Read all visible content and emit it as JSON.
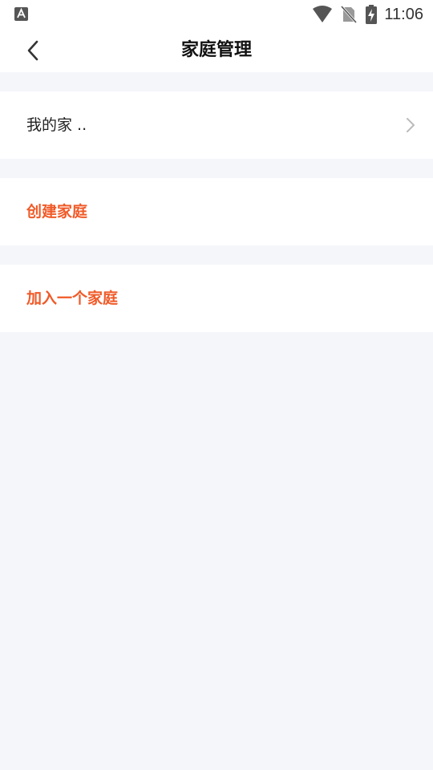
{
  "status_bar": {
    "time": "11:06",
    "icons": [
      "a-notification-icon",
      "wifi-icon",
      "no-sim-icon",
      "battery-charging-icon"
    ]
  },
  "header": {
    "title": "家庭管理"
  },
  "list": {
    "home_item": "我的家 ..",
    "create_family": "创建家庭",
    "join_family": "加入一个家庭"
  },
  "colors": {
    "accent": "#f05a28",
    "background": "#f5f6fa",
    "surface": "#ffffff"
  }
}
